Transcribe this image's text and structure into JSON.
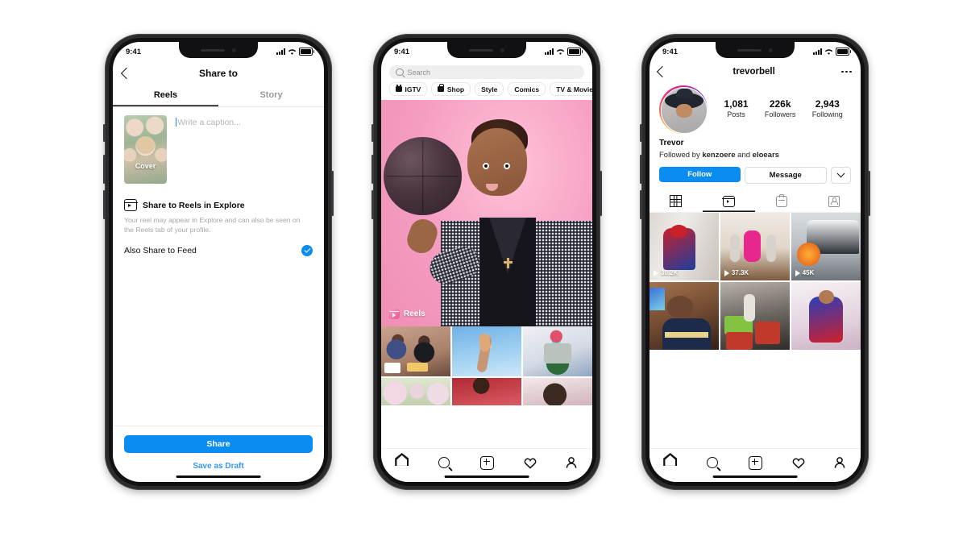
{
  "background_color": "#ffffff",
  "accent_color": "#0a8cf0",
  "phones": [
    {
      "id": "share-sheet",
      "status_bar": {
        "time": "9:41",
        "signal": "signal-icon",
        "wifi": "wifi-icon",
        "battery": "battery-icon"
      },
      "nav": {
        "back": "back-chevron-icon",
        "title": "Share to"
      },
      "tabs": [
        {
          "label": "Reels",
          "active": true
        },
        {
          "label": "Story",
          "active": false
        }
      ],
      "composer": {
        "cover_label": "Cover",
        "caption_placeholder": "Write a caption...",
        "caption_value": ""
      },
      "explore": {
        "icon": "reels-icon",
        "title": "Share to Reels in Explore",
        "helper": "Your reel may appear in Explore and can also be seen on the Reels tab of your profile."
      },
      "feed_toggle": {
        "label": "Also Share to Feed",
        "checked": true,
        "icon": "check-circle-icon"
      },
      "footer": {
        "share_label": "Share",
        "draft_label": "Save as Draft"
      }
    },
    {
      "id": "explore",
      "status_bar": {
        "time": "9:41"
      },
      "search": {
        "placeholder": "Search",
        "icon": "search-icon",
        "value": ""
      },
      "chips": [
        {
          "label": "IGTV",
          "icon": "igtv-icon"
        },
        {
          "label": "Shop",
          "icon": "shopping-bag-icon"
        },
        {
          "label": "Style",
          "icon": ""
        },
        {
          "label": "Comics",
          "icon": ""
        },
        {
          "label": "TV & Movie",
          "icon": ""
        }
      ],
      "hero": {
        "badge_label": "Reels",
        "badge_icon": "reels-icon"
      },
      "tab_bar": [
        {
          "name": "home-icon"
        },
        {
          "name": "search-icon"
        },
        {
          "name": "create-icon"
        },
        {
          "name": "heart-icon"
        },
        {
          "name": "profile-icon"
        }
      ]
    },
    {
      "id": "profile",
      "status_bar": {
        "time": "9:41"
      },
      "nav": {
        "back": "back-chevron-icon",
        "title": "trevorbell",
        "more": "more-options-icon"
      },
      "stats": [
        {
          "value": "1,081",
          "label": "Posts"
        },
        {
          "value": "226k",
          "label": "Followers"
        },
        {
          "value": "2,943",
          "label": "Following"
        }
      ],
      "bio": {
        "name": "Trevor",
        "followed_by_prefix": "Followed by ",
        "followed_by_1": "kenzoere",
        "followed_by_mid": " and ",
        "followed_by_2": "eloears"
      },
      "actions": {
        "follow": "Follow",
        "message": "Message",
        "more_icon": "chevron-down-icon"
      },
      "tabs": [
        {
          "icon": "grid-icon",
          "active": false
        },
        {
          "icon": "reels-icon",
          "active": true
        },
        {
          "icon": "shop-icon",
          "active": false
        },
        {
          "icon": "tagged-icon",
          "active": false
        }
      ],
      "reels": [
        {
          "views": "30.2K"
        },
        {
          "views": "37.3K"
        },
        {
          "views": "45K"
        },
        {
          "views": ""
        },
        {
          "views": ""
        },
        {
          "views": ""
        }
      ],
      "tab_bar": [
        {
          "name": "home-icon"
        },
        {
          "name": "search-icon"
        },
        {
          "name": "create-icon"
        },
        {
          "name": "heart-icon"
        },
        {
          "name": "profile-icon"
        }
      ]
    }
  ]
}
